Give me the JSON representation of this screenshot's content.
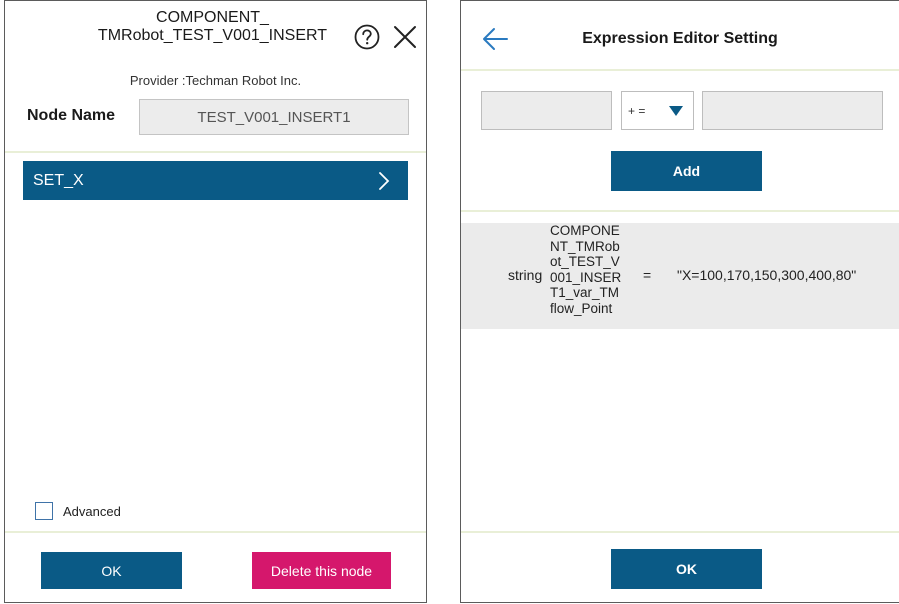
{
  "node_settings": {
    "title_line1": "COMPONENT_",
    "title_line2": "TMRobot_TEST_V001_INSERT",
    "provider": "Provider :Techman Robot Inc.",
    "node_name_label": "Node Name",
    "node_name_value": "TEST_V001_INSERT1",
    "items": [
      {
        "label": "SET_X"
      }
    ],
    "advanced_label": "Advanced",
    "advanced_checked": false,
    "ok_label": "OK",
    "delete_label": "Delete this node",
    "icons": [
      "help-icon",
      "close-icon",
      "chevron-right-icon"
    ]
  },
  "expression_editor": {
    "title": "Expression Editor Setting",
    "left_operand": "",
    "operator": "+ =",
    "right_operand": "",
    "add_label": "Add",
    "expressions": [
      {
        "type": "string",
        "name": "COMPONENT_TMRobot_TEST_V001_INSERT1_var_TMflow_Point",
        "operator": "=",
        "value": "\"X=100,170,150,300,400,80\""
      }
    ],
    "ok_label": "OK",
    "icons": [
      "back-arrow-icon",
      "dropdown-caret-icon"
    ]
  },
  "colors": {
    "primary": "#0a5a86",
    "danger": "#d5176c",
    "divider": "#e9efd7",
    "field_bg": "#ececec"
  }
}
